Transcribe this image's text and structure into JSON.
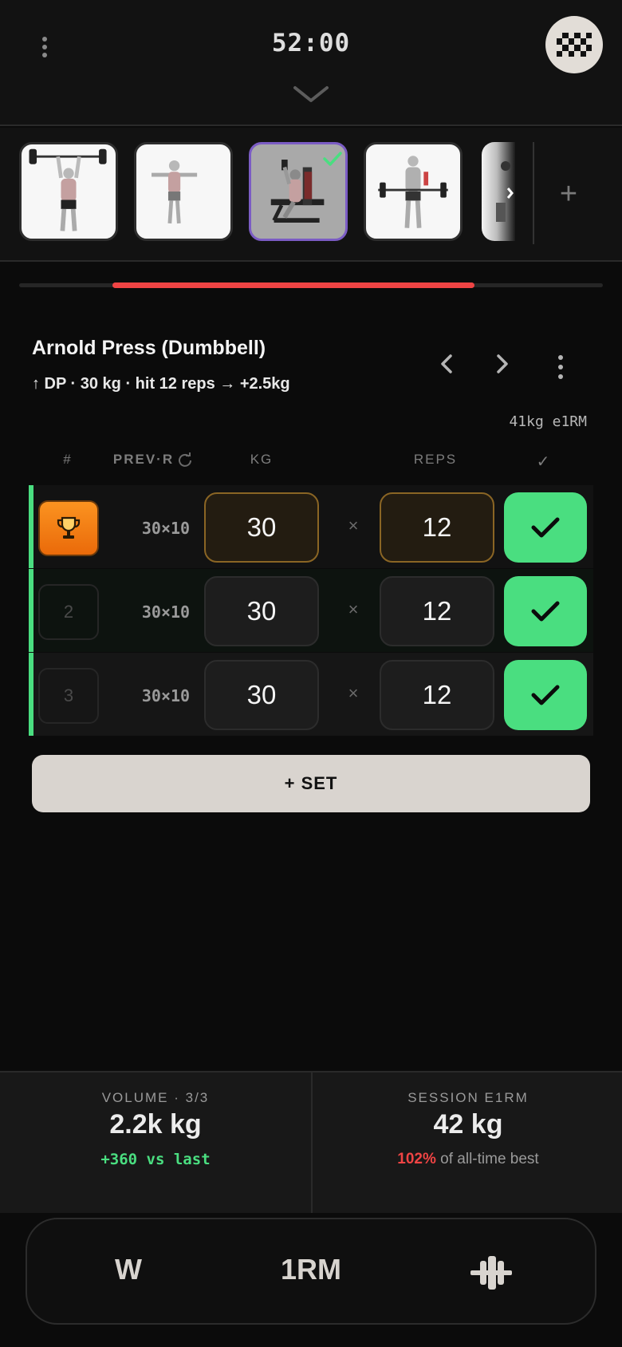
{
  "header": {
    "timer": "52:00",
    "menu_icon": "kebab-icon",
    "collapse_icon": "chevron-down-icon",
    "finish_icon": "checkered-flag-icon"
  },
  "strip": {
    "thumbnails": [
      {
        "name": "overhead barbell press",
        "state": "default"
      },
      {
        "name": "lateral raise",
        "state": "default"
      },
      {
        "name": "arnold press",
        "state": "active",
        "completed": true
      },
      {
        "name": "barbell curl",
        "state": "default"
      },
      {
        "name": "next exercise",
        "state": "partial"
      }
    ],
    "add_label": "+"
  },
  "progress": {
    "fraction_start": 0.16,
    "fraction_end": 0.78,
    "color": "#ef4444"
  },
  "exercise": {
    "title": "Arnold Press (Dumbbell)",
    "subtitle": "↑ DP · 30 kg · hit 12 reps → +2.5kg",
    "e1rm": "41kg e1RM"
  },
  "table": {
    "col_num": "#",
    "col_prev": "PREV·R",
    "col_kg": "KG",
    "col_reps": "REPS",
    "col_check": "✓",
    "times": "×",
    "rows": [
      {
        "num": "",
        "pr": true,
        "prev": "30×10",
        "kg": "30",
        "reps": "12",
        "done": true
      },
      {
        "num": "2",
        "pr": false,
        "prev": "30×10",
        "kg": "30",
        "reps": "12",
        "done": true
      },
      {
        "num": "3",
        "pr": false,
        "prev": "30×10",
        "kg": "30",
        "reps": "12",
        "done": true
      }
    ]
  },
  "add_set_label": "+ SET",
  "stats": {
    "volume_label": "VOLUME · 3/3",
    "volume_value": "2.2k kg",
    "volume_delta": "+360 vs last",
    "session_label": "SESSION E1RM",
    "session_value": "42 kg",
    "session_pct": "102%",
    "session_suffix": " of all-time best"
  },
  "toolbar": {
    "warmup_label": "W",
    "onerm_label": "1RM",
    "plate_icon": "plate-calculator-icon"
  },
  "colors": {
    "accent_green": "#4ade80",
    "accent_red": "#ef4444",
    "pr_orange": "#f97316",
    "active_purple": "#7b5cc4"
  }
}
